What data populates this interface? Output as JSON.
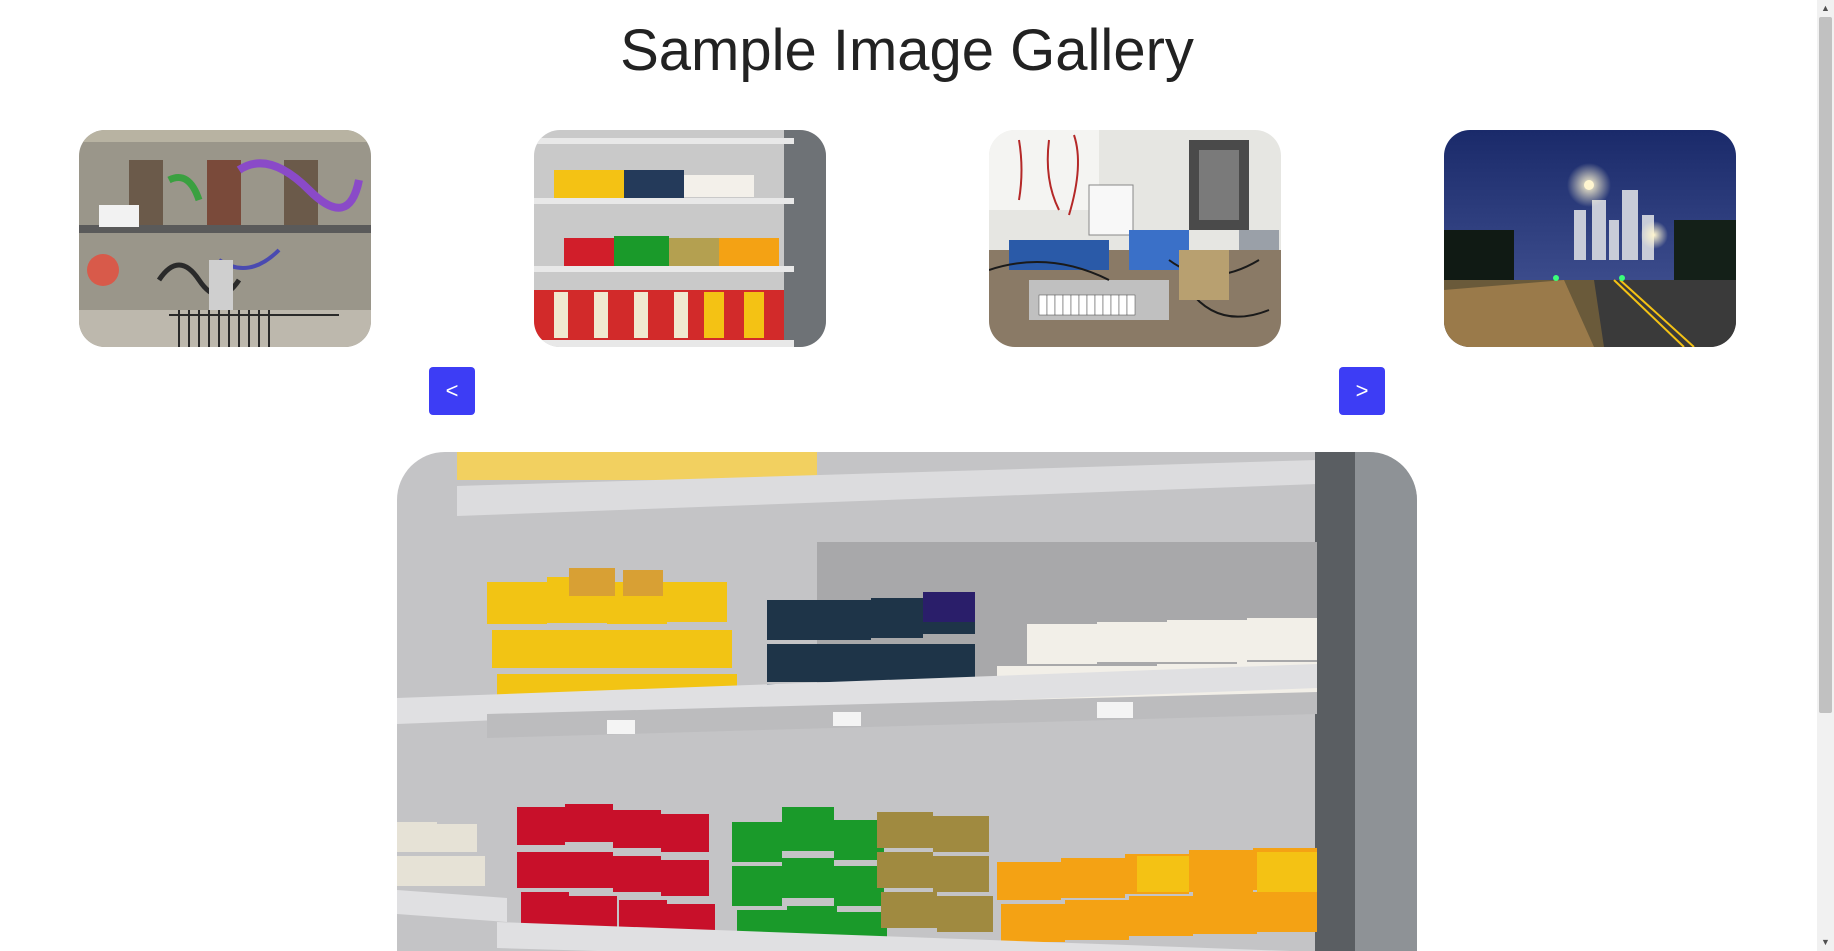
{
  "page": {
    "title": "Sample Image Gallery"
  },
  "thumbnails": [
    {
      "icon": "graffiti-building-photo"
    },
    {
      "icon": "cheese-shelf-photo"
    },
    {
      "icon": "electronics-workbench-photo"
    },
    {
      "icon": "city-night-street-photo"
    }
  ],
  "nav": {
    "prev_label": "<",
    "next_label": ">"
  },
  "main_image": {
    "icon": "cheese-shelf-photo"
  },
  "colors": {
    "nav_button": "#3d3df5",
    "title": "#222222"
  }
}
